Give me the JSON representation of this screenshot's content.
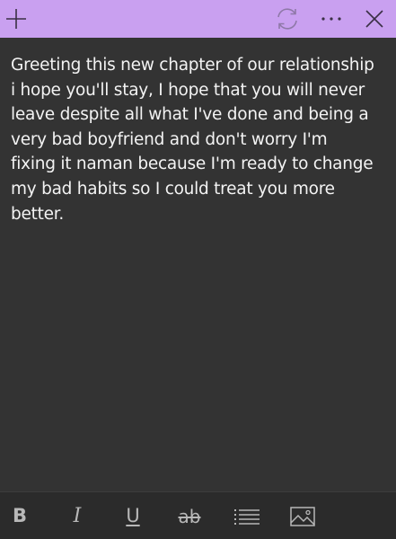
{
  "titlebar": {
    "accent_color": "#c9a0f0",
    "buttons": [
      {
        "icon": "plus-icon",
        "action": "new-note"
      },
      {
        "icon": "sync-icon",
        "action": "sync"
      },
      {
        "icon": "more-icon",
        "action": "menu"
      },
      {
        "icon": "close-icon",
        "action": "close"
      }
    ]
  },
  "note": {
    "text": "Greeting this new chapter of our relationship i hope you'll stay, I hope that you will never leave despite all what I've done and being a very bad boyfriend and don't worry I'm fixing it naman because I'm ready to change my bad habits so I could treat you more better."
  },
  "toolbar": {
    "bold_label": "B",
    "italic_label": "I",
    "underline_label": "U",
    "strike_label": "ab",
    "list_icon": "bullet-list-icon",
    "image_icon": "image-icon"
  }
}
